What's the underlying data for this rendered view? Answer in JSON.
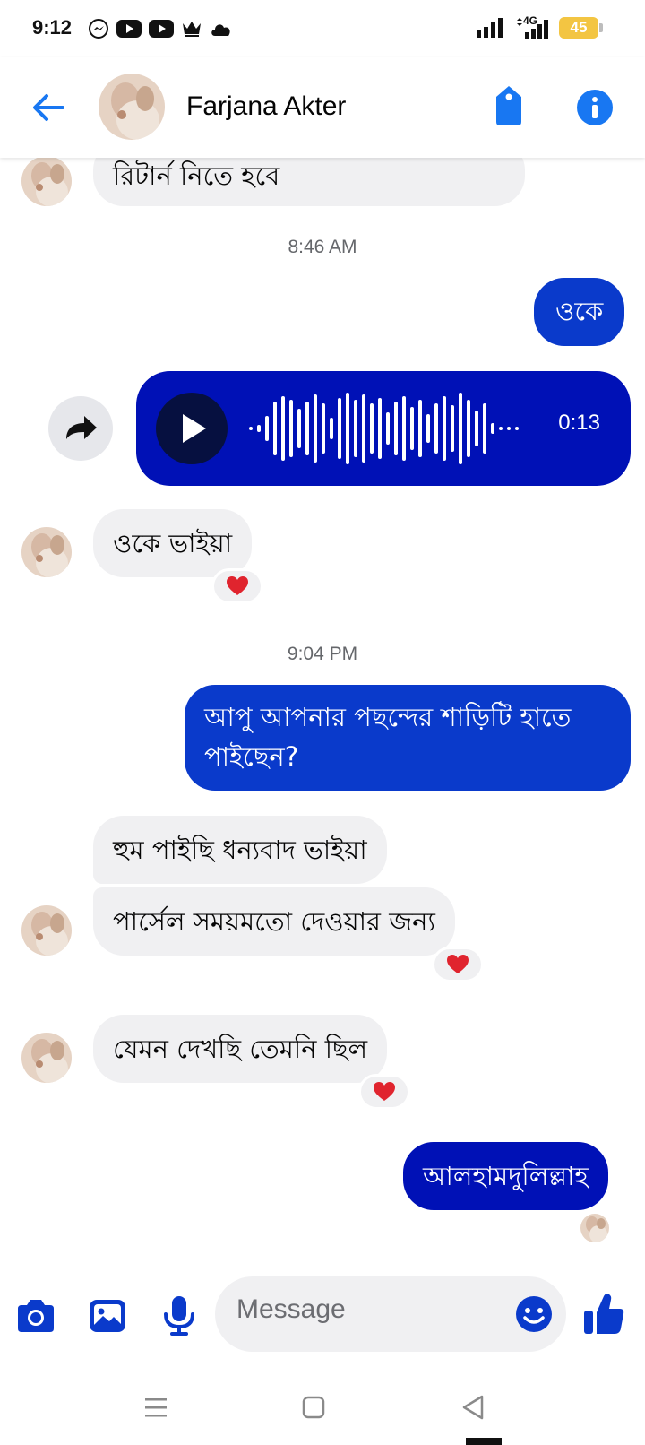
{
  "status_bar": {
    "time": "9:12",
    "network": "4G",
    "battery": "45"
  },
  "header": {
    "contact_name": "Farjana Akter"
  },
  "messages": {
    "m1": "রিটার্ন নিতে হবে",
    "ts1": "8:46 AM",
    "m2": "ওকে",
    "voice_duration": "0:13",
    "m3": "ওকে ভাইয়া",
    "ts2": "9:04 PM",
    "m4_line1": "আপু আপনার পছন্দের শাড়িটি হাতে",
    "m4_line2": "পাইছেন?",
    "m5": "হুম পাইছি ধন্যবাদ ভাইয়া",
    "m6": "পার্সেল সময়মতো দেওয়ার জন্য",
    "m7": "যেমন দেখছি তেমনি ছিল",
    "m8": "আলহামদুলিল্লাহ"
  },
  "composer": {
    "placeholder": "Message"
  },
  "colors": {
    "accent": "#0a3acb",
    "outgoing_dark": "#0011b6",
    "incoming": "#f0f0f2",
    "messenger_blue": "#1877f2",
    "reaction_heart": "#e0242e"
  },
  "icons": [
    "messenger-icon",
    "youtube-icon",
    "crown-icon",
    "cloud-icon",
    "signal-icon",
    "back-arrow-icon",
    "tag-icon",
    "info-icon",
    "play-icon",
    "forward-icon",
    "heart-icon",
    "camera-icon",
    "gallery-icon",
    "mic-icon",
    "emoji-icon",
    "thumbs-up-icon",
    "menu-icon",
    "home-icon",
    "back-icon"
  ]
}
